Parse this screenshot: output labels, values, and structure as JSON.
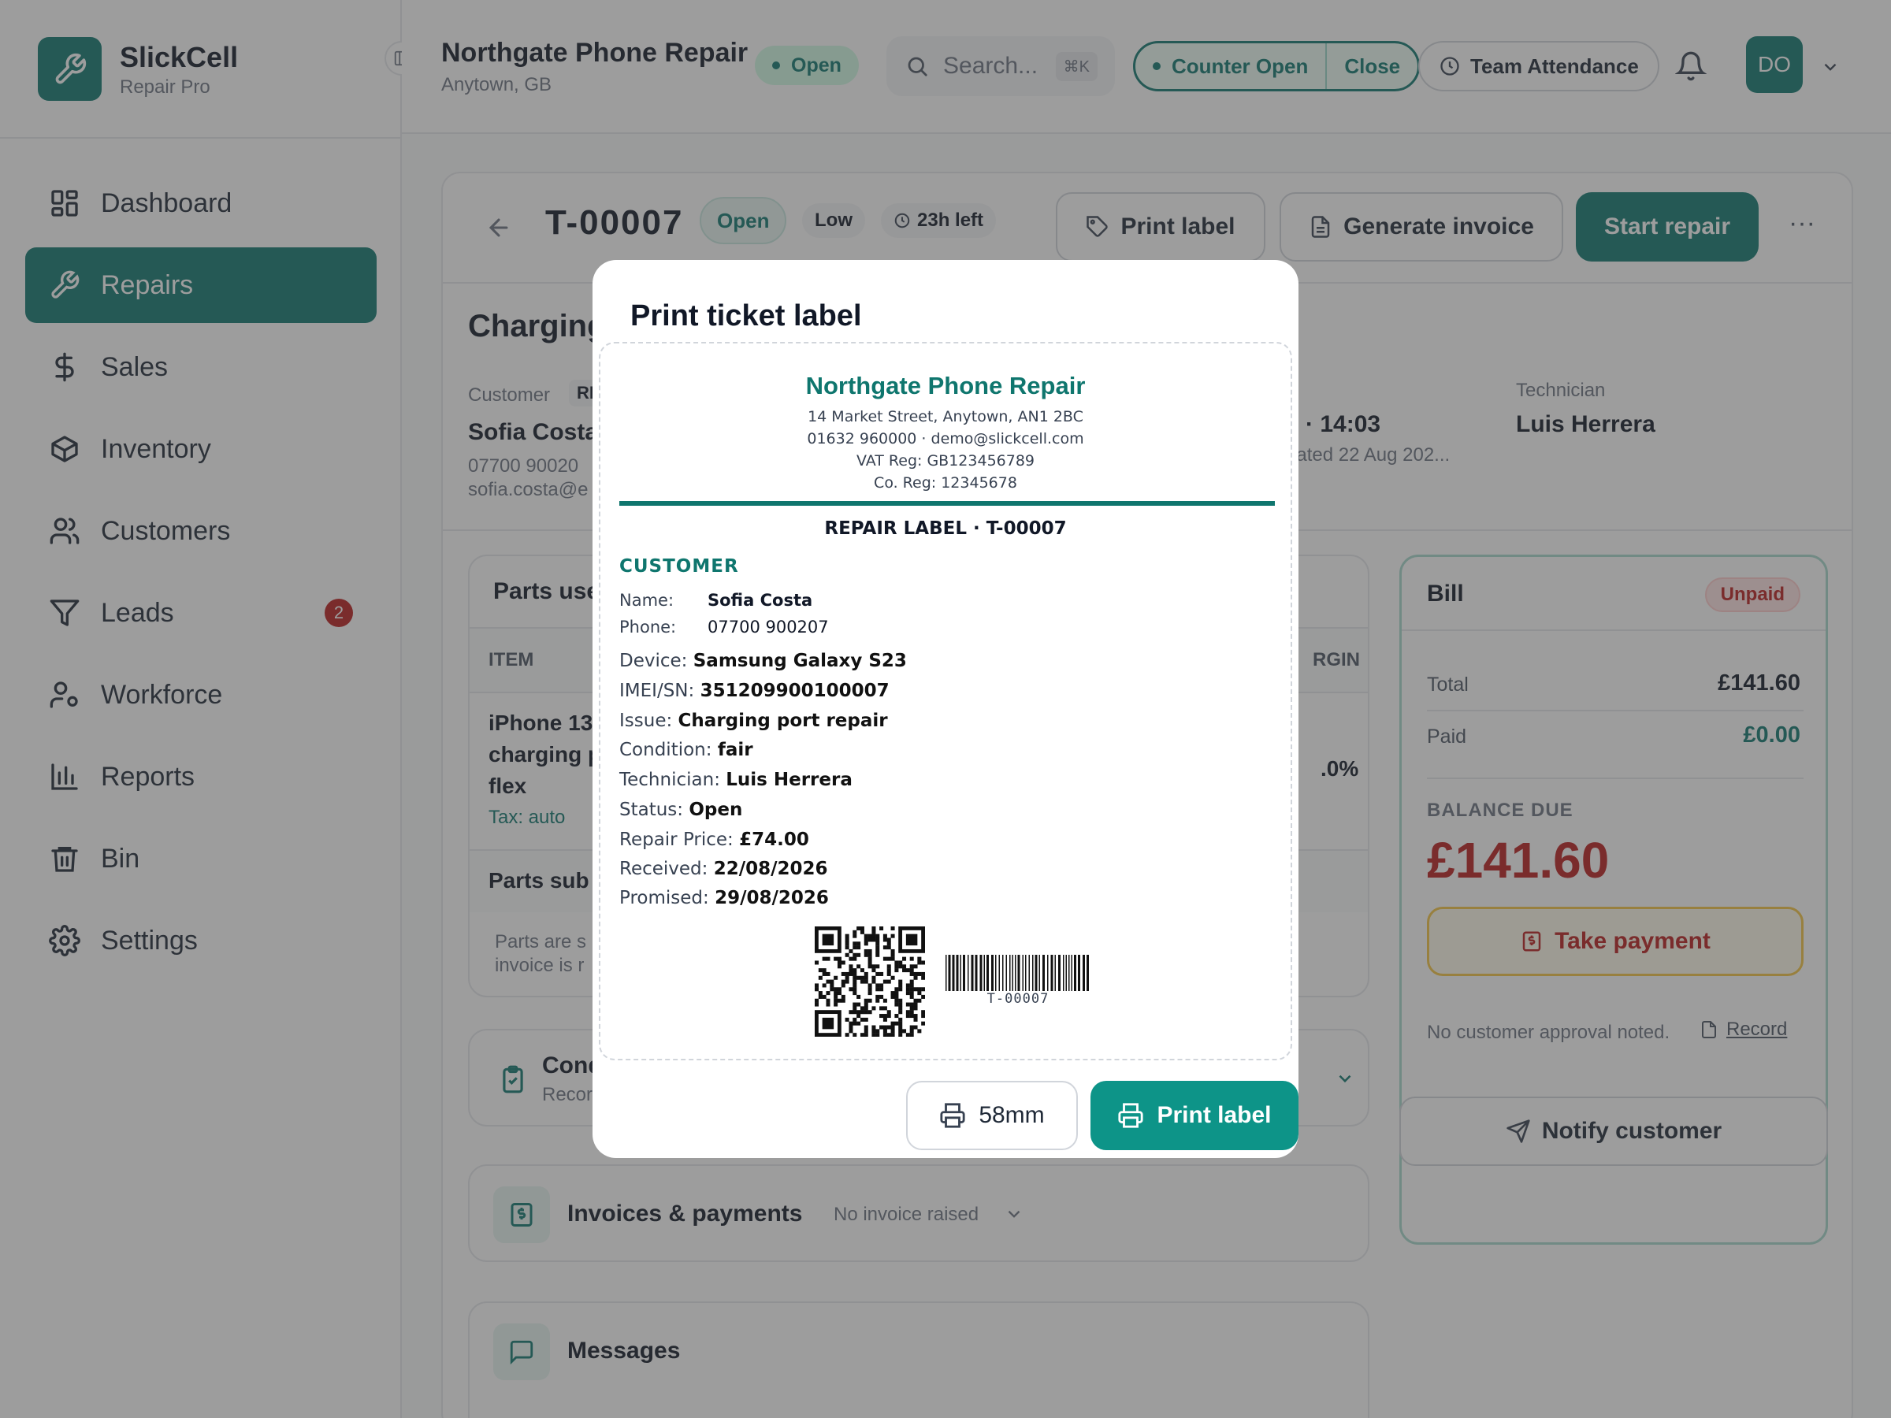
{
  "brand": {
    "name": "SlickCell",
    "sub": "Repair Pro"
  },
  "nav": [
    {
      "label": "Dashboard"
    },
    {
      "label": "Repairs"
    },
    {
      "label": "Sales"
    },
    {
      "label": "Inventory"
    },
    {
      "label": "Customers"
    },
    {
      "label": "Leads",
      "badge": "2"
    },
    {
      "label": "Workforce"
    },
    {
      "label": "Reports"
    },
    {
      "label": "Bin"
    },
    {
      "label": "Settings"
    }
  ],
  "topbar": {
    "shop_name": "Northgate Phone Repair",
    "location": "Anytown, GB",
    "status": "Open",
    "search_placeholder": "Search...",
    "search_shortcut": "⌘K",
    "counter_open": "Counter Open",
    "counter_close": "Close",
    "team_attendance": "Team Attendance",
    "avatar_initials": "DO"
  },
  "ticket": {
    "id": "T-00007",
    "status": "Open",
    "priority": "Low",
    "time_left": "23h left",
    "print_label": "Print label",
    "generate_invoice": "Generate invoice",
    "start_repair": "Start repair",
    "title_partial": "Charging",
    "customer_label": "Customer",
    "customer_tag": "RE",
    "customer_name": "Sofia Costa",
    "customer_phone": "07700 90020",
    "customer_email": "sofia.costa@e",
    "promised_partial": "6 · 14:03",
    "created_partial": "eated 22 Aug 202...",
    "technician_label": "Technician",
    "technician_name": "Luis Herrera"
  },
  "parts": {
    "title": "Parts use",
    "col_item": "ITEM",
    "col_margin": "RGIN",
    "item_line1": "iPhone 13",
    "item_line2": "charging p",
    "item_line3": "flex",
    "item_tax": "Tax: auto",
    "item_margin": ".0%",
    "subtotal": "Parts sub",
    "note_line1": "Parts are s",
    "note_line2": "invoice is r"
  },
  "condition": {
    "title": "Cond",
    "sub": "Recor"
  },
  "invoices": {
    "title": "Invoices & payments",
    "status": "No invoice raised"
  },
  "messages": {
    "title": "Messages"
  },
  "bill": {
    "title": "Bill",
    "status": "Unpaid",
    "total_label": "Total",
    "total": "£141.60",
    "paid_label": "Paid",
    "paid": "£0.00",
    "balance_label": "BALANCE DUE",
    "balance": "£141.60",
    "take_payment": "Take payment",
    "approval_note": "No customer approval noted.",
    "record": "Record"
  },
  "notify": "Notify customer",
  "modal": {
    "title": "Print ticket label",
    "shop_name": "Northgate Phone Repair",
    "address": "14 Market Street, Anytown, AN1 2BC",
    "contact": "01632 960000 · demo@slickcell.com",
    "vat": "VAT Reg: GB123456789",
    "co_reg": "Co. Reg: 12345678",
    "heading": "REPAIR LABEL · T-00007",
    "customer_heading": "CUSTOMER",
    "name_label": "Name:",
    "name": "Sofia Costa",
    "phone_label": "Phone:",
    "phone": "07700 900207",
    "fields": [
      {
        "label": "Device:",
        "value": "Samsung Galaxy S23"
      },
      {
        "label": "IMEI/SN:",
        "value": "351209900100007"
      },
      {
        "label": "Issue:",
        "value": "Charging port repair"
      },
      {
        "label": "Condition:",
        "value": "fair"
      },
      {
        "label": "Technician:",
        "value": "Luis Herrera"
      },
      {
        "label": "Status:",
        "value": "Open"
      },
      {
        "label": "Repair Price:",
        "value": "£74.00"
      },
      {
        "label": "Received:",
        "value": "22/08/2026"
      },
      {
        "label": "Promised:",
        "value": "29/08/2026"
      }
    ],
    "barcode_text": "T-00007",
    "size_button": "58mm",
    "print_button": "Print label"
  }
}
